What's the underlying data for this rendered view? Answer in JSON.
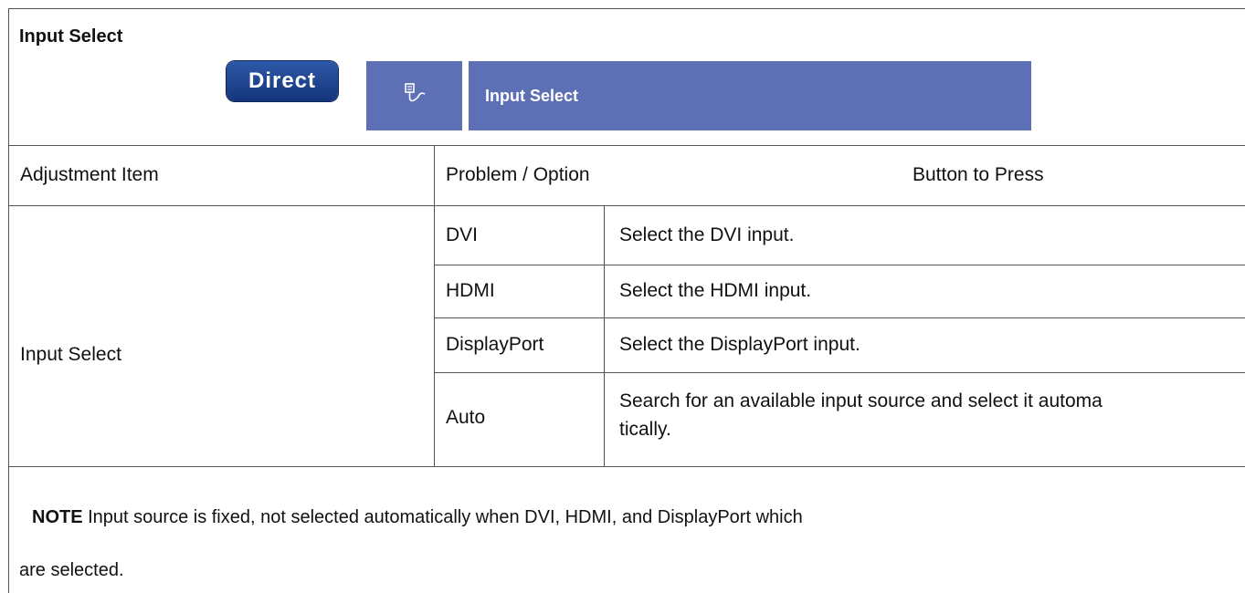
{
  "section": {
    "title": "Input Select",
    "direct_label": "Direct",
    "osd_title": "Input Select",
    "osd_icon": "input-plug-icon"
  },
  "table": {
    "headers": {
      "adjustment_item": "Adjustment Item",
      "problem_option": "Problem / Option",
      "button_to_press": "Button to Press"
    },
    "adjustment_item": "Input Select",
    "options": [
      {
        "name": "DVI",
        "description": "Select the DVI input."
      },
      {
        "name": "HDMI",
        "description": "Select the HDMI input."
      },
      {
        "name": "DisplayPort",
        "description": "Select the DisplayPort input."
      },
      {
        "name": "Auto",
        "description_line1": "Search for an available input source and select it automa",
        "description_line2": "tically."
      }
    ]
  },
  "note": {
    "label": "NOTE",
    "line1": "Input source is fixed, not selected automatically when DVI, HDMI, and DisplayPort which",
    "line2": "are selected."
  },
  "colors": {
    "osd_blue": "#5d6fb5",
    "direct_blue": "#1f438f",
    "border": "#555555"
  }
}
